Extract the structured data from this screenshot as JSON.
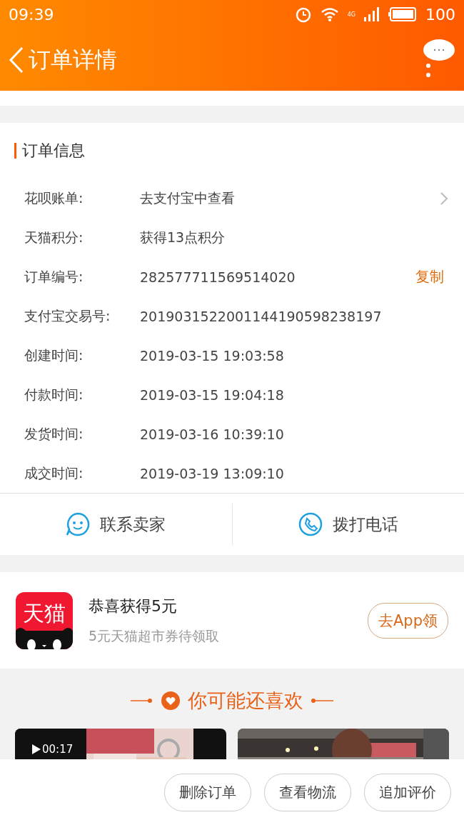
{
  "status_bar": {
    "time": "09:39",
    "network": "4G",
    "battery": "100"
  },
  "nav": {
    "title": "订单详情"
  },
  "order_info": {
    "title": "订单信息",
    "rows": [
      {
        "label": "花呗账单:",
        "value": "去支付宝中查看",
        "kind": "link"
      },
      {
        "label": "天猫积分:",
        "value": "获得13点积分",
        "kind": "plain"
      },
      {
        "label": "订单编号:",
        "value": "282577711569514020",
        "kind": "copy",
        "action": "复制"
      },
      {
        "label": "支付宝交易号:",
        "value": "2019031522001144190598238197",
        "kind": "plain"
      },
      {
        "label": "创建时间:",
        "value": "2019-03-15 19:03:58",
        "kind": "plain"
      },
      {
        "label": "付款时间:",
        "value": "2019-03-15 19:04:18",
        "kind": "plain"
      },
      {
        "label": "发货时间:",
        "value": "2019-03-16 10:39:10",
        "kind": "plain"
      },
      {
        "label": "成交时间:",
        "value": "2019-03-19 13:09:10",
        "kind": "plain"
      }
    ]
  },
  "contact": [
    {
      "label": "联系卖家",
      "kind": "chat"
    },
    {
      "label": "拨打电话",
      "kind": "phone"
    }
  ],
  "promo": {
    "logo_text": "天猫",
    "title": "恭喜获得5元",
    "subtitle": "5元天猫超市券待领取",
    "button": "去App领"
  },
  "recommend": {
    "title": "你可能还喜欢",
    "items": [
      {
        "kind": "picture",
        "video_time": "00:17"
      },
      {
        "kind": "picture"
      }
    ]
  },
  "actions": [
    "删除订单",
    "查看物流",
    "追加评价"
  ]
}
